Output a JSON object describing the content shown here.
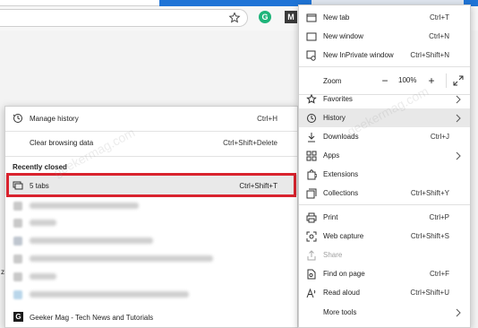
{
  "extensions": {
    "grammarly_letter": "G",
    "mendeley_letter": "M"
  },
  "main_menu": {
    "new_tab": {
      "label": "New tab",
      "shortcut": "Ctrl+T"
    },
    "new_window": {
      "label": "New window",
      "shortcut": "Ctrl+N"
    },
    "inprivate": {
      "label": "New InPrivate window",
      "shortcut": "Ctrl+Shift+N"
    },
    "zoom": {
      "label": "Zoom",
      "minus": "−",
      "value": "100%",
      "plus": "+"
    },
    "favorites": {
      "label": "Favorites"
    },
    "history": {
      "label": "History"
    },
    "downloads": {
      "label": "Downloads",
      "shortcut": "Ctrl+J"
    },
    "apps": {
      "label": "Apps"
    },
    "extensions": {
      "label": "Extensions"
    },
    "collections": {
      "label": "Collections",
      "shortcut": "Ctrl+Shift+Y"
    },
    "print": {
      "label": "Print",
      "shortcut": "Ctrl+P"
    },
    "web_capture": {
      "label": "Web capture",
      "shortcut": "Ctrl+Shift+S"
    },
    "share": {
      "label": "Share"
    },
    "find": {
      "label": "Find on page",
      "shortcut": "Ctrl+F"
    },
    "read_aloud": {
      "label": "Read aloud",
      "shortcut": "Ctrl+Shift+U"
    },
    "more_tools": {
      "label": "More tools"
    }
  },
  "history_menu": {
    "manage": {
      "label": "Manage history",
      "shortcut": "Ctrl+H"
    },
    "clear": {
      "label": "Clear browsing data",
      "shortcut": "Ctrl+Shift+Delete"
    },
    "recently_closed_title": "Recently closed",
    "tabs_entry": {
      "label": "5 tabs",
      "shortcut": "Ctrl+Shift+T"
    },
    "last_entry": {
      "label": "Geeker Mag - Tech News and Tutorials",
      "icon_letter": "G"
    }
  },
  "stray_text": "z",
  "watermark_text": "geekermag.com",
  "colors": {
    "highlight": "#d9232e",
    "accent": "#1f74d6",
    "grammarly": "#1fb47a"
  }
}
